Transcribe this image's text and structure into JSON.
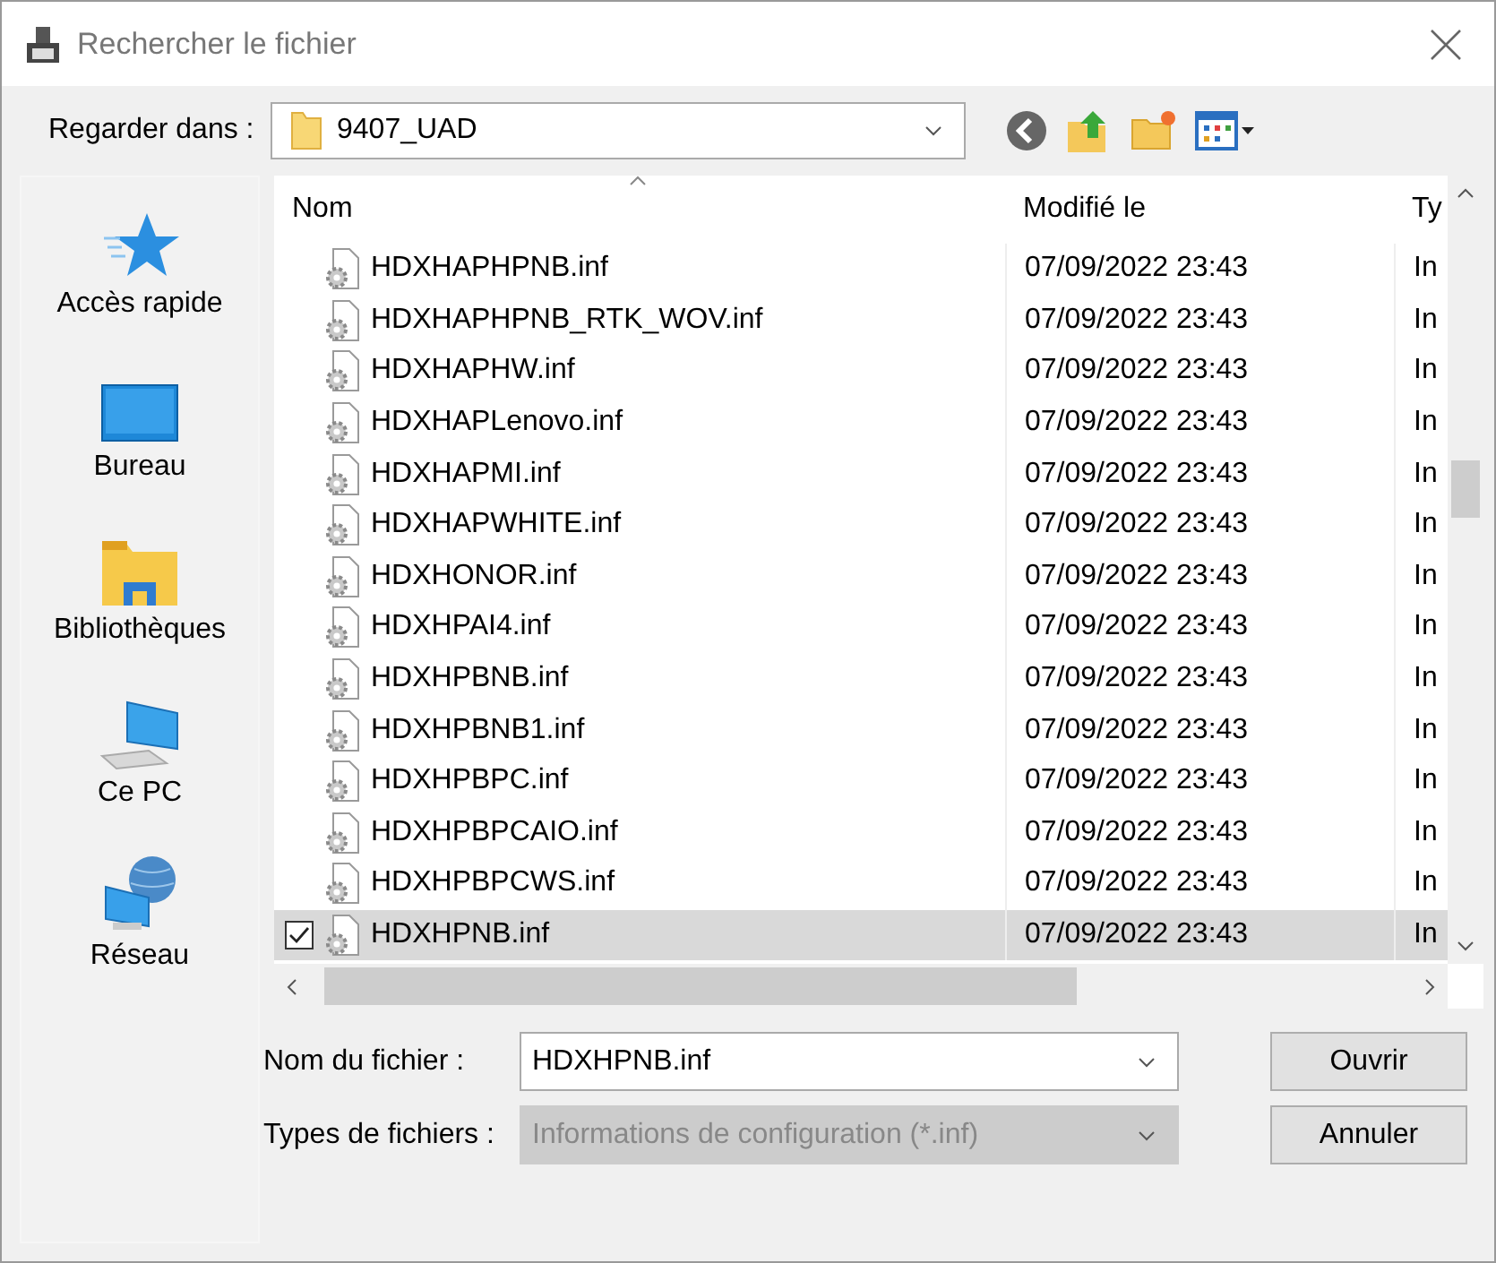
{
  "window": {
    "title": "Rechercher le fichier"
  },
  "look_in": {
    "label": "Regarder dans :",
    "value": "9407_UAD"
  },
  "sidebar": {
    "items": [
      {
        "label": "Accès rapide",
        "kind": "star"
      },
      {
        "label": "Bureau",
        "kind": "desktop"
      },
      {
        "label": "Bibliothèques",
        "kind": "library"
      },
      {
        "label": "Ce PC",
        "kind": "pc"
      },
      {
        "label": "Réseau",
        "kind": "network"
      }
    ]
  },
  "table": {
    "columns": [
      "Nom",
      "Modifié le",
      "Ty"
    ],
    "rows": [
      {
        "name": "HDXHAPHPNB.inf",
        "modified": "07/09/2022 23:43",
        "type": "In",
        "selected": false,
        "checked": false
      },
      {
        "name": "HDXHAPHPNB_RTK_WOV.inf",
        "modified": "07/09/2022 23:43",
        "type": "In",
        "selected": false,
        "checked": false
      },
      {
        "name": "HDXHAPHW.inf",
        "modified": "07/09/2022 23:43",
        "type": "In",
        "selected": false,
        "checked": false
      },
      {
        "name": "HDXHAPLenovo.inf",
        "modified": "07/09/2022 23:43",
        "type": "In",
        "selected": false,
        "checked": false
      },
      {
        "name": "HDXHAPMI.inf",
        "modified": "07/09/2022 23:43",
        "type": "In",
        "selected": false,
        "checked": false
      },
      {
        "name": "HDXHAPWHITE.inf",
        "modified": "07/09/2022 23:43",
        "type": "In",
        "selected": false,
        "checked": false
      },
      {
        "name": "HDXHONOR.inf",
        "modified": "07/09/2022 23:43",
        "type": "In",
        "selected": false,
        "checked": false
      },
      {
        "name": "HDXHPAI4.inf",
        "modified": "07/09/2022 23:43",
        "type": "In",
        "selected": false,
        "checked": false
      },
      {
        "name": "HDXHPBNB.inf",
        "modified": "07/09/2022 23:43",
        "type": "In",
        "selected": false,
        "checked": false
      },
      {
        "name": "HDXHPBNB1.inf",
        "modified": "07/09/2022 23:43",
        "type": "In",
        "selected": false,
        "checked": false
      },
      {
        "name": "HDXHPBPC.inf",
        "modified": "07/09/2022 23:43",
        "type": "In",
        "selected": false,
        "checked": false
      },
      {
        "name": "HDXHPBPCAIO.inf",
        "modified": "07/09/2022 23:43",
        "type": "In",
        "selected": false,
        "checked": false
      },
      {
        "name": "HDXHPBPCWS.inf",
        "modified": "07/09/2022 23:43",
        "type": "In",
        "selected": false,
        "checked": false
      },
      {
        "name": "HDXHPNB.inf",
        "modified": "07/09/2022 23:43",
        "type": "In",
        "selected": true,
        "checked": true
      }
    ]
  },
  "file_name": {
    "label": "Nom du fichier :",
    "value": "HDXHPNB.inf"
  },
  "file_type": {
    "label": "Types de fichiers :",
    "value": "Informations de configuration (*.inf)",
    "disabled": true
  },
  "buttons": [
    "Ouvrir",
    "Annuler"
  ]
}
